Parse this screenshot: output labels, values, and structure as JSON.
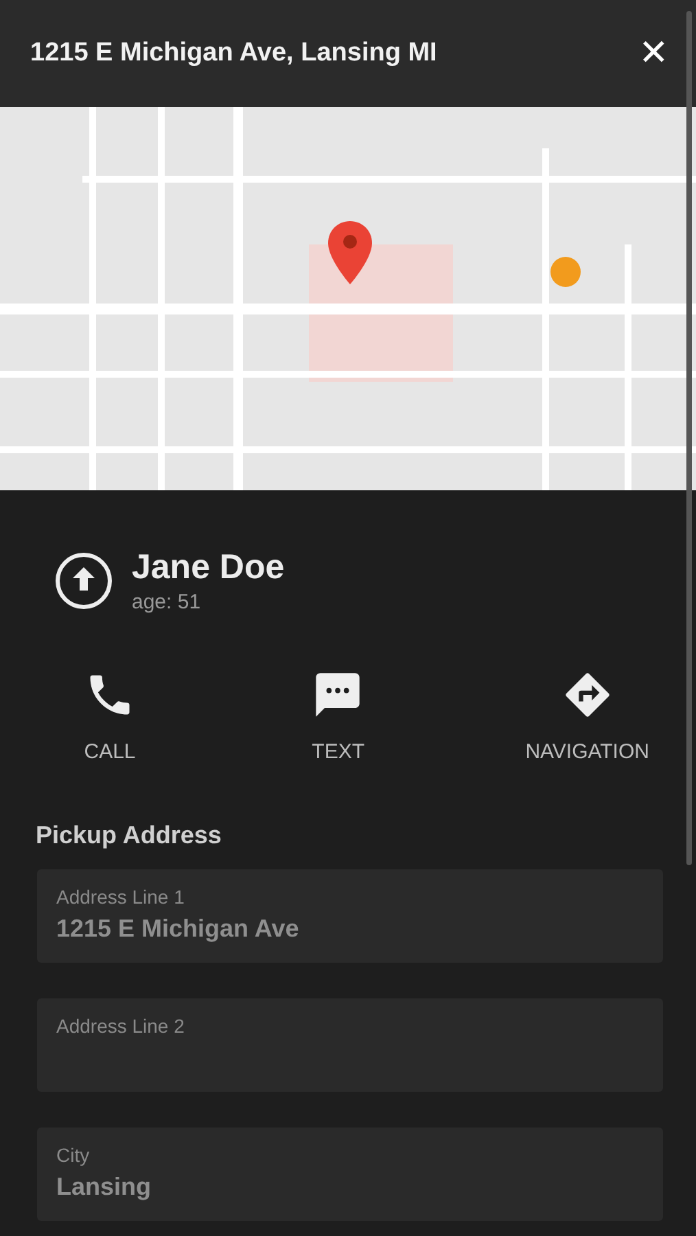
{
  "header": {
    "title": "1215 E Michigan Ave, Lansing MI",
    "close": "✕"
  },
  "patient": {
    "name": "Jane Doe",
    "age": "age: 51"
  },
  "actions": [
    {
      "kind": "phone",
      "label": "CALL"
    },
    {
      "kind": "message",
      "label": "TEXT"
    },
    {
      "kind": "navigation",
      "label": "NAVIGATION"
    }
  ],
  "section_title": "Pickup Address",
  "fields": [
    {
      "label": "Address Line 1",
      "value": "1215 E Michigan Ave"
    },
    {
      "label": "Address Line 2"
    },
    {
      "label": "City",
      "value": "Lansing"
    }
  ]
}
